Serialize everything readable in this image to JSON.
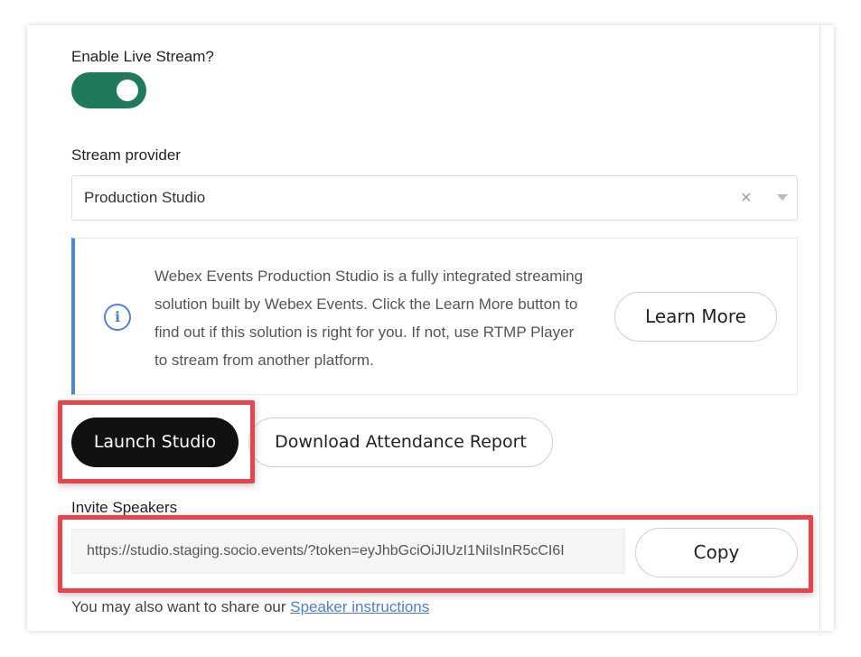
{
  "live_stream": {
    "label": "Enable Live Stream?",
    "enabled": true,
    "toggle_color": "#1f7a5a"
  },
  "stream_provider": {
    "label": "Stream provider",
    "value": "Production Studio",
    "clear_glyph": "×"
  },
  "info": {
    "icon": "info-icon",
    "icon_glyph": "i",
    "text": "Webex Events Production Studio is a fully integrated streaming solution built by Webex Events. Click the Learn More button to find out if this solution is right for you. If not, use RTMP Player to stream from another platform.",
    "learn_more_label": "Learn More",
    "accent_color": "#4a87dc"
  },
  "actions": {
    "launch_label": "Launch Studio",
    "download_label": "Download Attendance Report"
  },
  "invite": {
    "label": "Invite Speakers",
    "url": "https://studio.staging.socio.events/?token=eyJhbGciOiJIUzI1NiIsInR5cCI6I",
    "copy_label": "Copy",
    "share_prefix": "You may also want to share our ",
    "share_link": "Speaker instructions"
  },
  "highlight_color": "#e8454b"
}
